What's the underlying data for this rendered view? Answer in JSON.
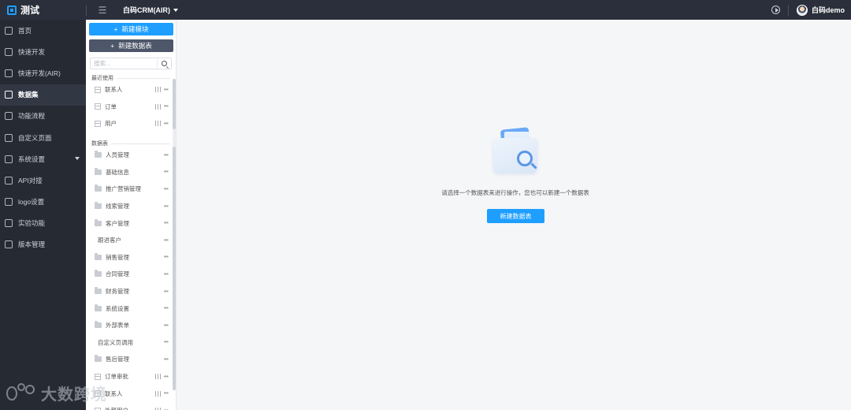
{
  "topbar": {
    "brand": "测试",
    "app_name": "白码CRM(AIR)",
    "user_name": "白码demo",
    "accent": "#1e9fff"
  },
  "nav": {
    "items": [
      {
        "label": "首页",
        "icon": "home-icon"
      },
      {
        "label": "快速开发",
        "icon": "cube-icon"
      },
      {
        "label": "快速开发(AIR)",
        "icon": "cube-icon"
      },
      {
        "label": "数据集",
        "icon": "database-icon",
        "active": true
      },
      {
        "label": "功能流程",
        "icon": "flow-icon"
      },
      {
        "label": "自定义页面",
        "icon": "page-icon"
      },
      {
        "label": "系统设置",
        "icon": "settings-icon",
        "has_caret": true
      },
      {
        "label": "API对接",
        "icon": "api-icon"
      },
      {
        "label": "logo设置",
        "icon": "image-icon"
      },
      {
        "label": "实验功能",
        "icon": "monitor-icon"
      },
      {
        "label": "版本管理",
        "icon": "monitor-icon"
      }
    ]
  },
  "tree": {
    "new_module_label": "新建模块",
    "new_table_label": "新建数据表",
    "search_placeholder": "搜索...",
    "recent_label": "最近使用",
    "recent": [
      "联系人",
      "订单",
      "用户"
    ],
    "tables_label": "数据表",
    "tables": [
      {
        "label": "人员管理",
        "type": "folder"
      },
      {
        "label": "基础信息",
        "type": "folder"
      },
      {
        "label": "推广营销管理",
        "type": "folder"
      },
      {
        "label": "线索管理",
        "type": "folder"
      },
      {
        "label": "客户管理",
        "type": "folder"
      },
      {
        "label": "跟进客户",
        "type": "plain"
      },
      {
        "label": "销售管理",
        "type": "folder"
      },
      {
        "label": "合同管理",
        "type": "folder"
      },
      {
        "label": "财务管理",
        "type": "folder"
      },
      {
        "label": "系统设置",
        "type": "folder"
      },
      {
        "label": "外部表单",
        "type": "folder"
      },
      {
        "label": "自定义页调用",
        "type": "plain"
      },
      {
        "label": "售后管理",
        "type": "folder"
      },
      {
        "label": "订单审批",
        "type": "table"
      },
      {
        "label": "联系人",
        "type": "table"
      },
      {
        "label": "外部用户",
        "type": "table"
      }
    ]
  },
  "main": {
    "empty_text": "请选择一个数据表来进行操作，您也可以新建一个数据表",
    "empty_button": "新建数据表"
  },
  "watermark": "大数跨境"
}
